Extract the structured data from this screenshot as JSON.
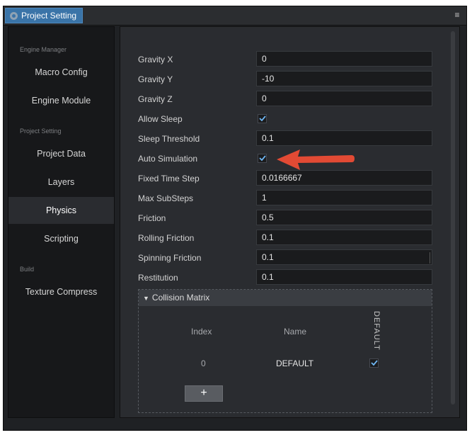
{
  "window": {
    "tab_title": "Project Setting",
    "menu_icon": "hamburger-menu-icon"
  },
  "sidebar": {
    "groups": [
      {
        "label": "Engine Manager",
        "items": [
          "Macro Config",
          "Engine Module"
        ]
      },
      {
        "label": "Project Setting",
        "items": [
          "Project Data",
          "Layers",
          "Physics",
          "Scripting"
        ]
      },
      {
        "label": "Build",
        "items": [
          "Texture Compress"
        ]
      }
    ],
    "active": "Physics"
  },
  "physics": {
    "gravity_x": {
      "label": "Gravity X",
      "value": "0"
    },
    "gravity_y": {
      "label": "Gravity Y",
      "value": "-10"
    },
    "gravity_z": {
      "label": "Gravity Z",
      "value": "0"
    },
    "allow_sleep": {
      "label": "Allow Sleep",
      "checked": true
    },
    "sleep_threshold": {
      "label": "Sleep Threshold",
      "value": "0.1"
    },
    "auto_simulation": {
      "label": "Auto Simulation",
      "checked": true
    },
    "fixed_time_step": {
      "label": "Fixed Time Step",
      "value": "0.0166667"
    },
    "max_substeps": {
      "label": "Max SubSteps",
      "value": "1"
    },
    "friction": {
      "label": "Friction",
      "value": "0.5"
    },
    "rolling_friction": {
      "label": "Rolling Friction",
      "value": "0.1"
    },
    "spinning_friction": {
      "label": "Spinning Friction",
      "value": "0.1"
    },
    "restitution": {
      "label": "Restitution",
      "value": "0.1"
    }
  },
  "collision_matrix": {
    "title": "Collision Matrix",
    "col_index": "Index",
    "col_name": "Name",
    "col_default": "DEFAULT",
    "rows": [
      {
        "index": "0",
        "name": "DEFAULT",
        "checked": true
      }
    ],
    "add_label": "+"
  },
  "colors": {
    "accent_tab": "#3a74a8",
    "annotation_arrow": "#e24a34",
    "checkmark": "#6fb6f2"
  }
}
